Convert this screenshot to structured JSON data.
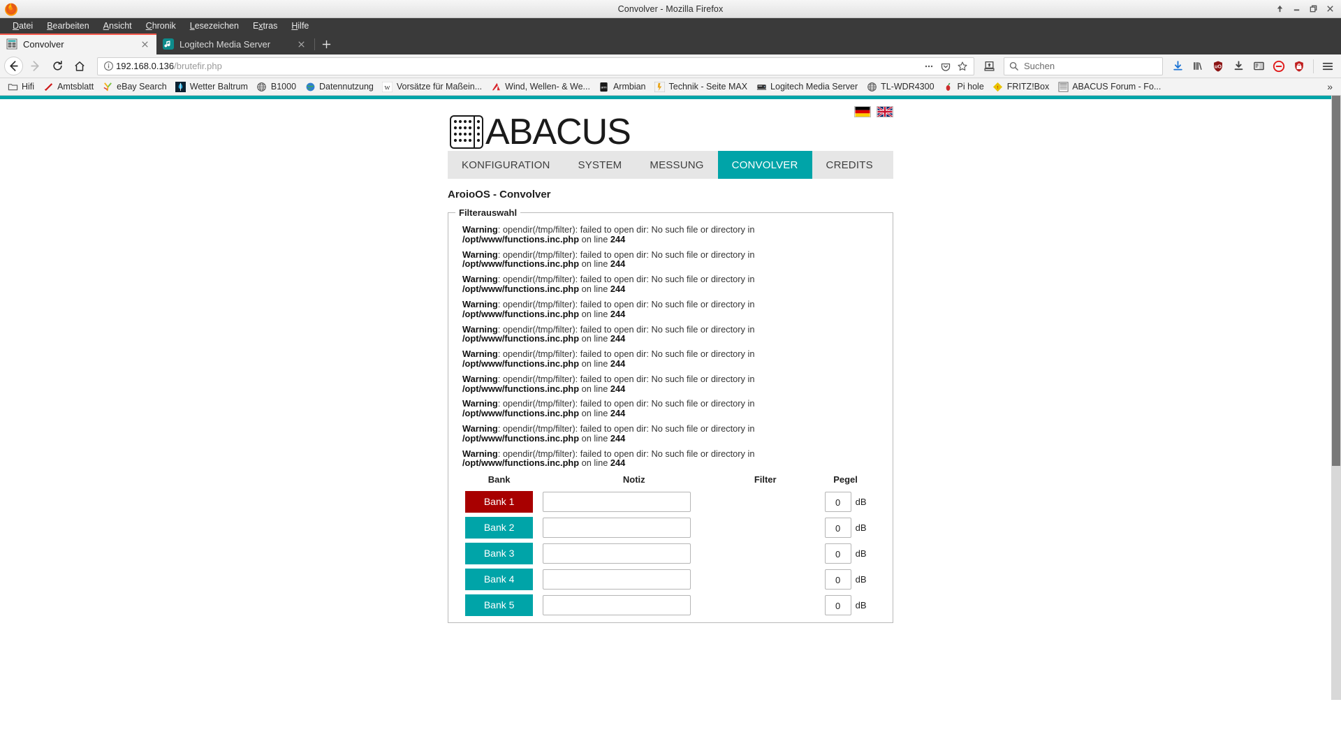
{
  "window": {
    "title": "Convolver - Mozilla Firefox",
    "controls": [
      "shade-button",
      "minimize-button",
      "maximize-button",
      "close-button"
    ]
  },
  "menubar": {
    "items": [
      {
        "label": "Datei",
        "accel": "D"
      },
      {
        "label": "Bearbeiten",
        "accel": "B"
      },
      {
        "label": "Ansicht",
        "accel": "A"
      },
      {
        "label": "Chronik",
        "accel": "C"
      },
      {
        "label": "Lesezeichen",
        "accel": "L"
      },
      {
        "label": "Extras",
        "accel": "x"
      },
      {
        "label": "Hilfe",
        "accel": "H"
      }
    ]
  },
  "tabs": [
    {
      "label": "Convolver",
      "icon": "page-icon",
      "active": true
    },
    {
      "label": "Logitech Media Server",
      "icon": "music-note-icon",
      "active": false
    }
  ],
  "newtab_label": "+",
  "navbar": {
    "back_icon": "back-arrow-icon",
    "forward_icon": "forward-arrow-icon",
    "reload_icon": "reload-icon",
    "home_icon": "home-icon",
    "url_host": "192.168.0.136",
    "url_path": "/brutefir.php",
    "identity_icon": "info-icon",
    "page_actions_icon": "ellipsis-icon",
    "pocket_icon": "pocket-icon",
    "bookmark_star_icon": "star-icon",
    "save-to-pocket_icon": "save-icon",
    "search_placeholder": "Suchen",
    "search_icon": "magnifier-icon",
    "toolbar_icons": [
      "downloads-icon",
      "library-icon",
      "ublock-origin-icon",
      "download-manager-icon",
      "reader-sidebar-icon",
      "adblock-icon",
      "noscript-icon"
    ],
    "menu_icon": "hamburger-menu-icon"
  },
  "bookmarks": {
    "items": [
      {
        "label": "Hifi",
        "icon": "folder-icon"
      },
      {
        "label": "Amtsblatt",
        "icon": "amtsblatt-icon"
      },
      {
        "label": "eBay Search",
        "icon": "ebay-icon"
      },
      {
        "label": "Wetter Baltrum",
        "icon": "weather-icon"
      },
      {
        "label": "B1000",
        "icon": "globe-icon"
      },
      {
        "label": "Datennutzung",
        "icon": "earth-icon"
      },
      {
        "label": "Vorsätze für Maßein...",
        "icon": "wikipedia-icon"
      },
      {
        "label": "Wind, Wellen- & We...",
        "icon": "windfinder-icon"
      },
      {
        "label": "Armbian",
        "icon": "armbian-icon"
      },
      {
        "label": "Technik - Seite MAX",
        "icon": "technik-icon"
      },
      {
        "label": "Logitech Media Server",
        "icon": "server-icon"
      },
      {
        "label": "TL-WDR4300",
        "icon": "globe-icon"
      },
      {
        "label": "Pi hole",
        "icon": "pihole-icon"
      },
      {
        "label": "FRITZ!Box",
        "icon": "fritzbox-icon"
      },
      {
        "label": "ABACUS Forum - Fo...",
        "icon": "page-icon"
      }
    ],
    "overflow_label": "»"
  },
  "site": {
    "brand": "ABACUS",
    "brand_logo_icon": "abacus-logo-icon",
    "languages": [
      {
        "name": "german-flag-icon",
        "code": "de"
      },
      {
        "name": "uk-flag-icon",
        "code": "en"
      }
    ],
    "accent_color": "#00a4a8",
    "nav": [
      {
        "label": "KONFIGURATION",
        "active": false
      },
      {
        "label": "SYSTEM",
        "active": false
      },
      {
        "label": "MESSUNG",
        "active": false
      },
      {
        "label": "CONVOLVER",
        "active": true
      },
      {
        "label": "CREDITS",
        "active": false
      }
    ],
    "page_title": "AroioOS - Convolver",
    "fieldset_legend": "Filterauswahl",
    "warnings": [
      {
        "label": "Warning",
        "text1": ": opendir(/tmp/filter): failed to open dir: No such file or directory in ",
        "path": "/opt/www/functions.inc.php",
        "text2": " on line ",
        "line": "244"
      },
      {
        "label": "Warning",
        "text1": ": opendir(/tmp/filter): failed to open dir: No such file or directory in ",
        "path": "/opt/www/functions.inc.php",
        "text2": " on line ",
        "line": "244"
      },
      {
        "label": "Warning",
        "text1": ": opendir(/tmp/filter): failed to open dir: No such file or directory in ",
        "path": "/opt/www/functions.inc.php",
        "text2": " on line ",
        "line": "244"
      },
      {
        "label": "Warning",
        "text1": ": opendir(/tmp/filter): failed to open dir: No such file or directory in ",
        "path": "/opt/www/functions.inc.php",
        "text2": " on line ",
        "line": "244"
      },
      {
        "label": "Warning",
        "text1": ": opendir(/tmp/filter): failed to open dir: No such file or directory in ",
        "path": "/opt/www/functions.inc.php",
        "text2": " on line ",
        "line": "244"
      },
      {
        "label": "Warning",
        "text1": ": opendir(/tmp/filter): failed to open dir: No such file or directory in ",
        "path": "/opt/www/functions.inc.php",
        "text2": " on line ",
        "line": "244"
      },
      {
        "label": "Warning",
        "text1": ": opendir(/tmp/filter): failed to open dir: No such file or directory in ",
        "path": "/opt/www/functions.inc.php",
        "text2": " on line ",
        "line": "244"
      },
      {
        "label": "Warning",
        "text1": ": opendir(/tmp/filter): failed to open dir: No such file or directory in ",
        "path": "/opt/www/functions.inc.php",
        "text2": " on line ",
        "line": "244"
      },
      {
        "label": "Warning",
        "text1": ": opendir(/tmp/filter): failed to open dir: No such file or directory in ",
        "path": "/opt/www/functions.inc.php",
        "text2": " on line ",
        "line": "244"
      },
      {
        "label": "Warning",
        "text1": ": opendir(/tmp/filter): failed to open dir: No such file or directory in ",
        "path": "/opt/www/functions.inc.php",
        "text2": " on line ",
        "line": "244"
      }
    ],
    "table": {
      "headers": [
        "Bank",
        "Notiz",
        "Filter",
        "Pegel"
      ],
      "unit": "dB",
      "rows": [
        {
          "bank": "Bank 1",
          "notiz": "",
          "filter": "",
          "pegel": "0",
          "selected": true
        },
        {
          "bank": "Bank 2",
          "notiz": "",
          "filter": "",
          "pegel": "0",
          "selected": false
        },
        {
          "bank": "Bank 3",
          "notiz": "",
          "filter": "",
          "pegel": "0",
          "selected": false
        },
        {
          "bank": "Bank 4",
          "notiz": "",
          "filter": "",
          "pegel": "0",
          "selected": false
        },
        {
          "bank": "Bank 5",
          "notiz": "",
          "filter": "",
          "pegel": "0",
          "selected": false
        }
      ]
    }
  }
}
